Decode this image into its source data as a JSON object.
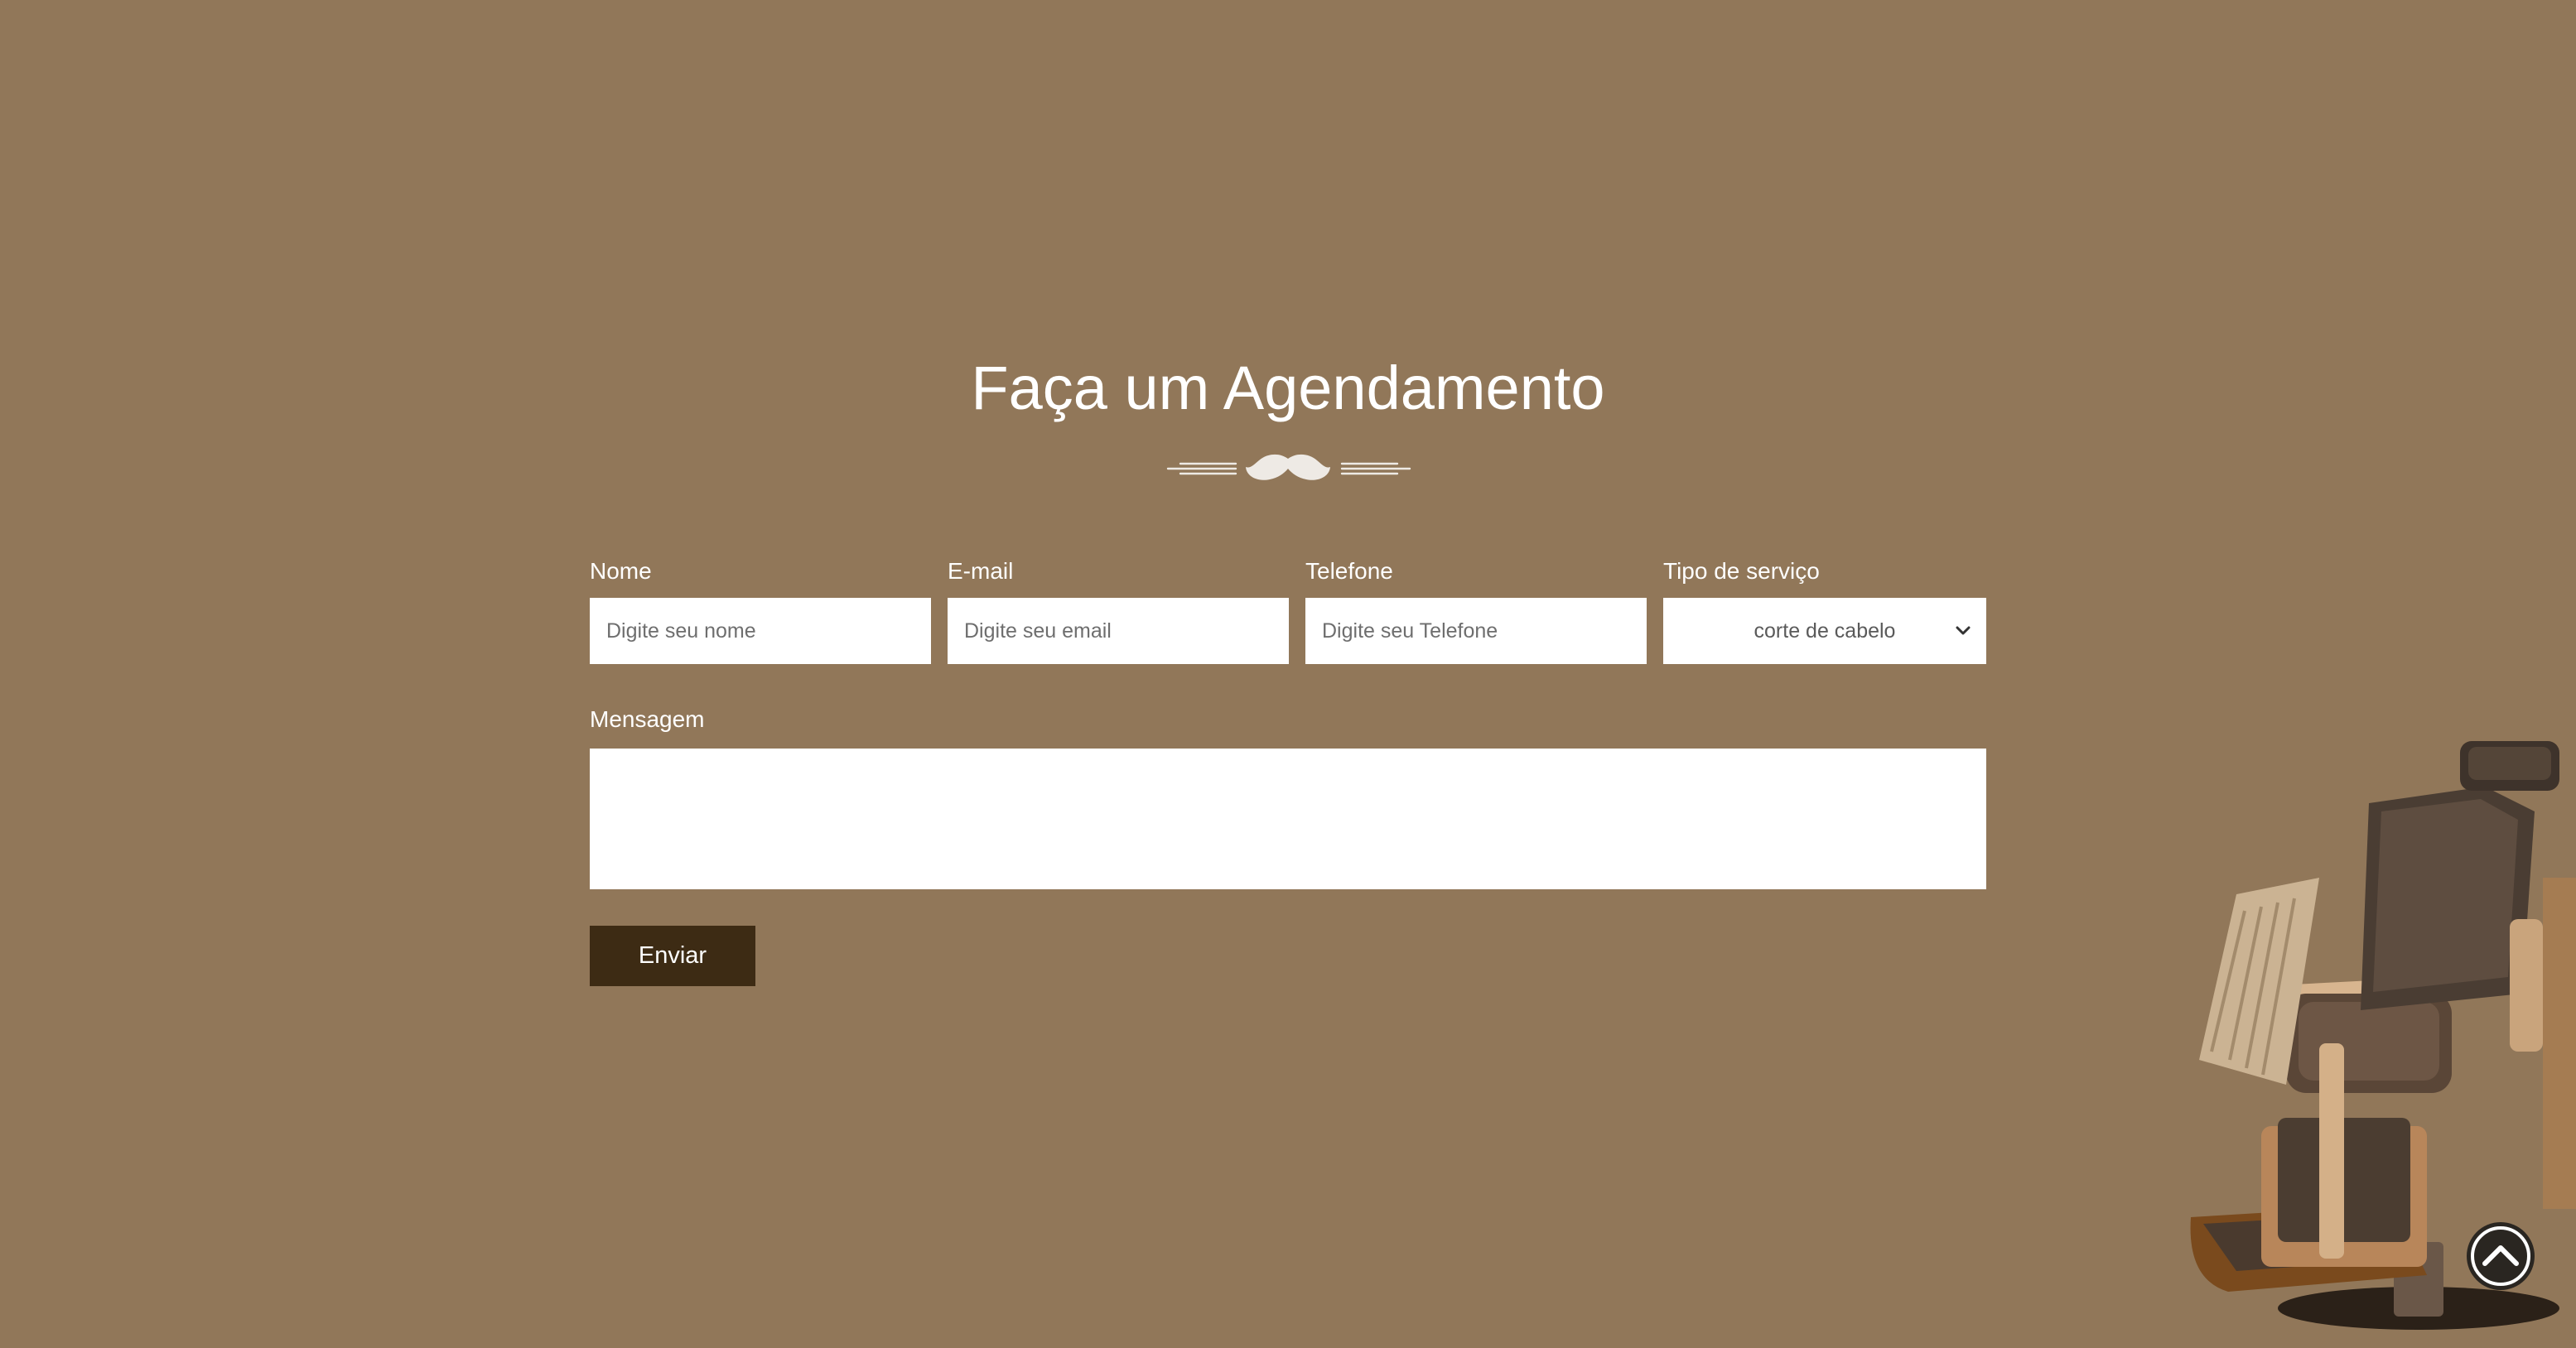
{
  "page": {
    "title": "Faça um Agendamento"
  },
  "form": {
    "name": {
      "label": "Nome",
      "placeholder": "Digite seu nome",
      "value": ""
    },
    "email": {
      "label": "E-mail",
      "placeholder": "Digite seu email",
      "value": ""
    },
    "phone": {
      "label": "Telefone",
      "placeholder": "Digite seu Telefone",
      "value": ""
    },
    "service": {
      "label": "Tipo de serviço",
      "selected": "corte de cabelo"
    },
    "message": {
      "label": "Mensagem",
      "value": ""
    },
    "submit_label": "Enviar"
  },
  "icons": {
    "divider": "mustache-icon",
    "back_to_top": "chevron-up-circle-icon",
    "dropdown": "chevron-down-icon"
  },
  "colors": {
    "background": "#917759",
    "button": "#3d2b14",
    "text": "#ffffff"
  }
}
